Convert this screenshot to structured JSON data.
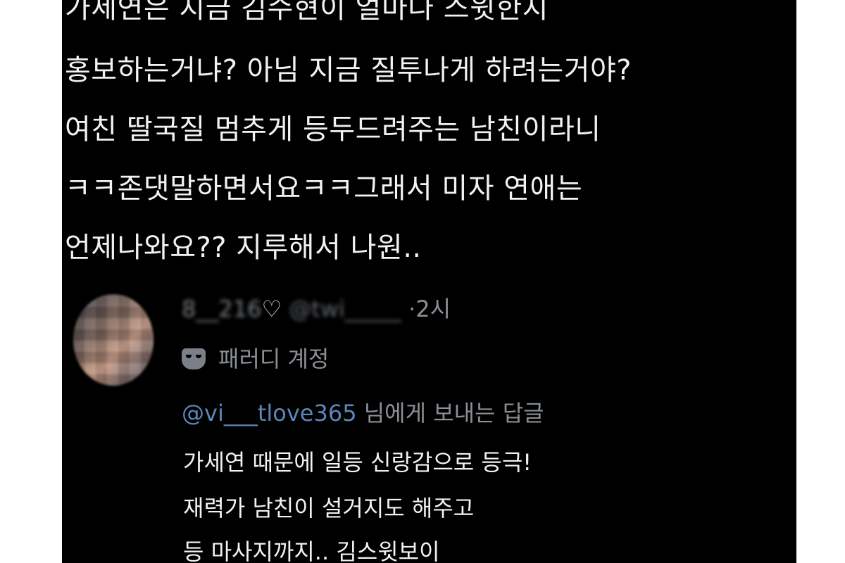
{
  "post": {
    "lines": [
      "가세연은 지금 김수현이 얼마나 스윗한지",
      "홍보하는거냐? 아님 지금 질투나게 하려는거야?",
      "여친 딸국질 멈추게 등두드려주는 남친이라니",
      "ㅋㅋ존댓말하면서요ㅋㅋ그래서 미자 연애는",
      "언제나와요?? 지루해서 나원.."
    ]
  },
  "reply": {
    "display_name": "8__216",
    "heart": "♡",
    "handle": "@twi_____",
    "separator": "·",
    "time": "2시",
    "parody_label": "패러디 계정",
    "mask_icon": "theater-mask-icon",
    "mention": "@vi___tlove365",
    "reply_suffix": "님에게 보내는 답글",
    "body_lines": [
      "가세연 때문에 일등 신랑감으로 등극!",
      "재력가 남친이 설거지도 해주고",
      "등 마사지까지.. 김스윗보이"
    ]
  },
  "colors": {
    "background": "#000000",
    "text": "#f2f2f2",
    "muted": "#8b8f96",
    "mention": "#5c86b8"
  }
}
